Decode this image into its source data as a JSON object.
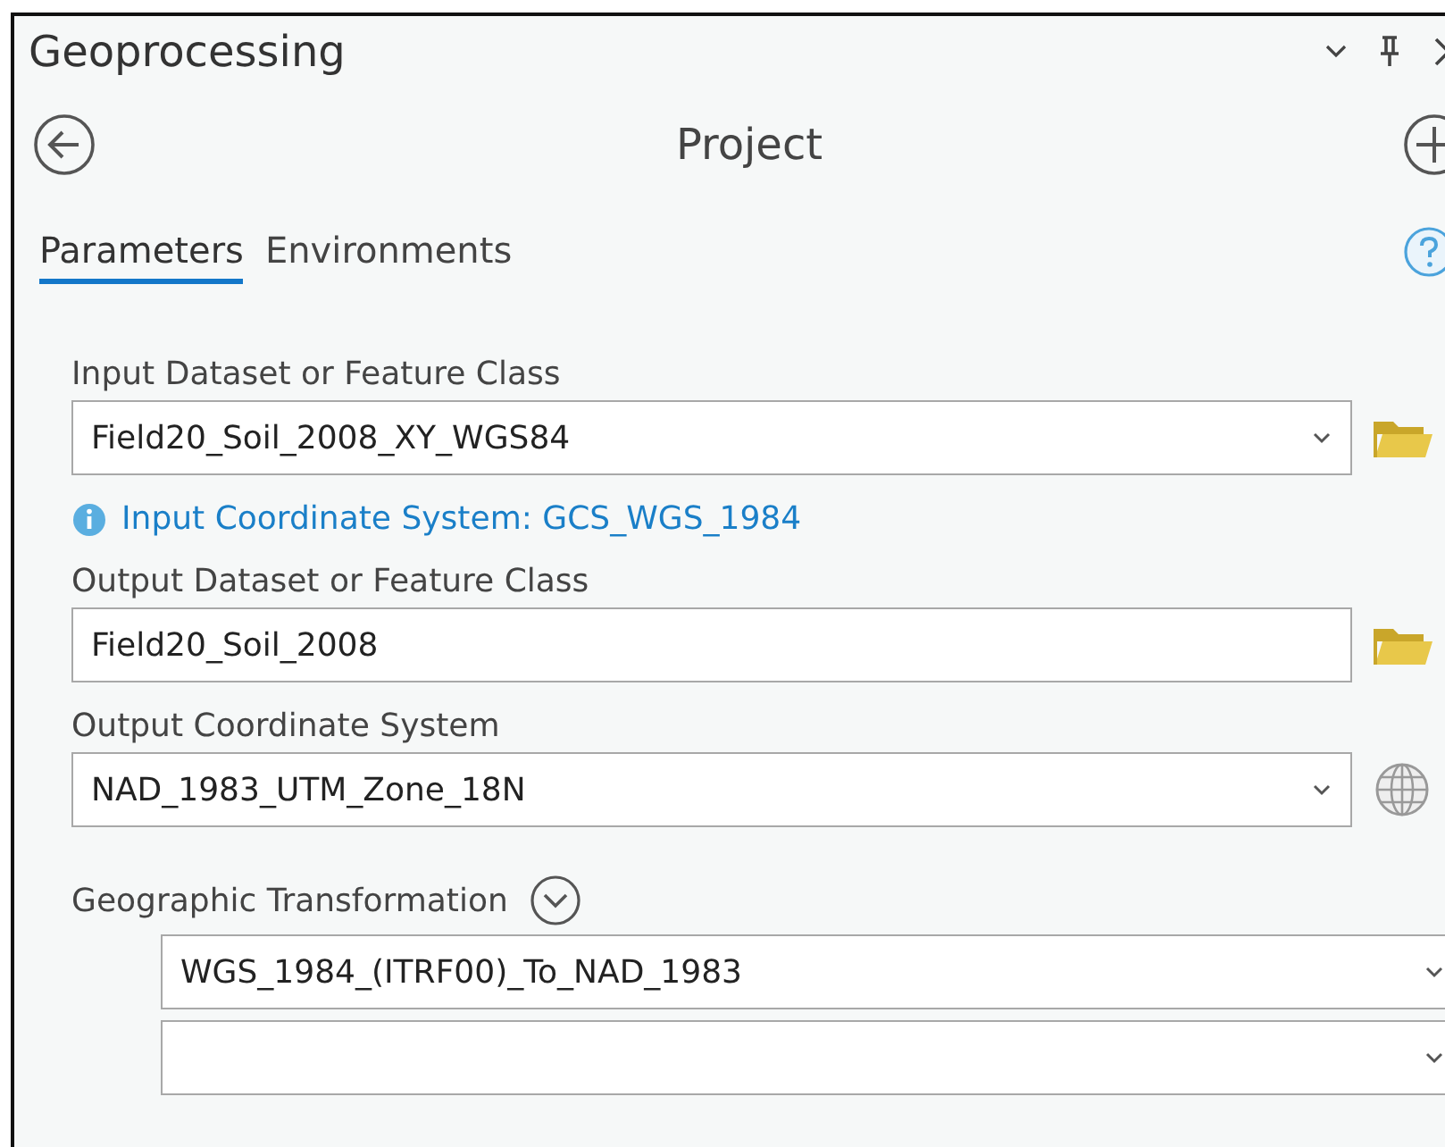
{
  "window": {
    "title": "Geoprocessing"
  },
  "header": {
    "title": "Project"
  },
  "tabs": [
    {
      "label": "Parameters",
      "selected": true
    },
    {
      "label": "Environments",
      "selected": false
    }
  ],
  "parameters": [
    {
      "label": "Input Dataset or Feature Class",
      "value": "Field20_Soil_2008_XY_WGS84",
      "kind": "combo",
      "side": {
        "kind": "folder"
      },
      "info": "Input Coordinate System: GCS_WGS_1984"
    },
    {
      "label": "Output Dataset or Feature Class",
      "value": "Field20_Soil_2008",
      "kind": "text",
      "side": {
        "kind": "folder"
      }
    },
    {
      "label": "Output Coordinate System",
      "value": "NAD_1983_UTM_Zone_18N",
      "kind": "combo",
      "side": {
        "kind": "globe"
      }
    }
  ],
  "transformation": {
    "label": "Geographic Transformation",
    "expanded": true,
    "fields": [
      {
        "kind": "combo",
        "value": "WGS_1984_(ITRF00)_To_NAD_1983"
      },
      {
        "kind": "combo"
      }
    ]
  }
}
